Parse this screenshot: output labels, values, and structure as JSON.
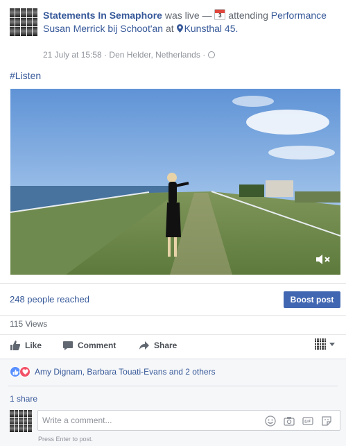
{
  "post": {
    "author": "Statements In Semaphore",
    "status": "was live —",
    "activity": "attending",
    "calendar_day": "3",
    "event": "Performance Susan Merrick bij Schoot'an",
    "at": "at",
    "place": "Kunsthal 45.",
    "timestamp": "21 July at 15:58",
    "location": "Den Helder, Netherlands",
    "separator": "·",
    "hashtag": "#Listen"
  },
  "video": {
    "muted": true
  },
  "insights": {
    "reached": "248 people reached",
    "boost_label": "Boost post",
    "views": "115 Views"
  },
  "actions": {
    "like": "Like",
    "comment": "Comment",
    "share": "Share"
  },
  "feedback": {
    "reaction_names": "Amy Dignam, Barbara Touati-Evans and 2 others",
    "shares": "1 share",
    "comment_placeholder": "Write a comment...",
    "hint": "Press Enter to post."
  },
  "colors": {
    "link": "#365899",
    "boost": "#4267b2",
    "like_reaction": "#5890ff",
    "love_reaction": "#f25268"
  }
}
